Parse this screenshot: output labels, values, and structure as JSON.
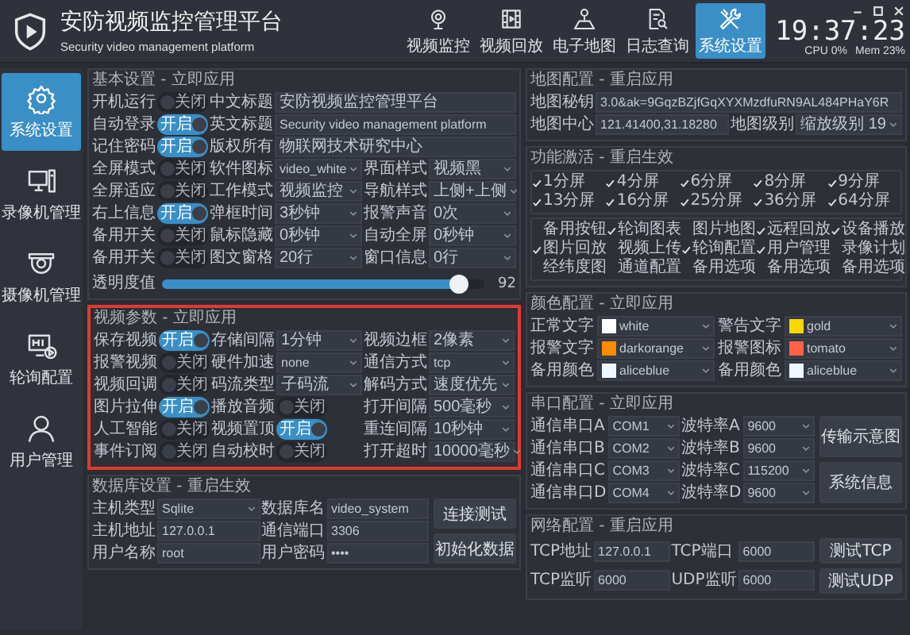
{
  "header": {
    "title": "安防视频监控管理平台",
    "subtitle": "Security video management platform",
    "nav": [
      {
        "label": "视频监控",
        "selected": false
      },
      {
        "label": "视频回放",
        "selected": false
      },
      {
        "label": "电子地图",
        "selected": false
      },
      {
        "label": "日志查询",
        "selected": false
      },
      {
        "label": "系统设置",
        "selected": true
      }
    ],
    "clock": "19:37:23",
    "cpu": "CPU 0%",
    "mem": "Mem 23%"
  },
  "sidebar": {
    "items": [
      {
        "label": "系统设置",
        "selected": true
      },
      {
        "label": "录像机管理",
        "selected": false
      },
      {
        "label": "摄像机管理",
        "selected": false
      },
      {
        "label": "轮询配置",
        "selected": false
      },
      {
        "label": "用户管理",
        "selected": false
      }
    ]
  },
  "basic": {
    "title": "基本设置 - 立即应用",
    "rows": [
      {
        "cells": [
          {
            "kind": "toggle",
            "label": "开机运行",
            "on": false,
            "text": "关闭"
          },
          {
            "kind": "field",
            "label": "中文标题",
            "value": "安防视频监控管理平台"
          }
        ]
      },
      {
        "cells": [
          {
            "kind": "toggle",
            "label": "自动登录",
            "on": true,
            "text": "开启"
          },
          {
            "kind": "field",
            "label": "英文标题",
            "value": "Security video management platform"
          }
        ]
      },
      {
        "cells": [
          {
            "kind": "toggle",
            "label": "记住密码",
            "on": true,
            "text": "开启"
          },
          {
            "kind": "field",
            "label": "版权所有",
            "value": "物联网技术研究中心"
          }
        ]
      },
      {
        "cells": [
          {
            "kind": "toggle",
            "label": "全屏模式",
            "on": false,
            "text": "关闭"
          },
          {
            "kind": "select",
            "label": "软件图标",
            "value": "video_white"
          },
          {
            "kind": "select",
            "label": "界面样式",
            "value": "视频黑"
          }
        ]
      },
      {
        "cells": [
          {
            "kind": "toggle",
            "label": "全屏适应",
            "on": false,
            "text": "关闭"
          },
          {
            "kind": "select",
            "label": "工作模式",
            "value": "视频监控"
          },
          {
            "kind": "select",
            "label": "导航样式",
            "value": "上侧+上侧"
          }
        ]
      },
      {
        "cells": [
          {
            "kind": "toggle",
            "label": "右上信息",
            "on": true,
            "text": "开启"
          },
          {
            "kind": "select",
            "label": "弹框时间",
            "value": "3秒钟"
          },
          {
            "kind": "select",
            "label": "报警声音",
            "value": "0次"
          }
        ]
      },
      {
        "cells": [
          {
            "kind": "toggle",
            "label": "备用开关",
            "on": false,
            "text": "关闭"
          },
          {
            "kind": "select",
            "label": "鼠标隐藏",
            "value": "0秒钟"
          },
          {
            "kind": "select",
            "label": "自动全屏",
            "value": "0秒钟"
          }
        ]
      },
      {
        "cells": [
          {
            "kind": "toggle",
            "label": "备用开关",
            "on": false,
            "text": "关闭"
          },
          {
            "kind": "select",
            "label": "图文窗格",
            "value": "20行"
          },
          {
            "kind": "select",
            "label": "窗口信息",
            "value": "0行"
          }
        ]
      }
    ],
    "slider": {
      "label": "透明度值",
      "level": 0.92,
      "reading": "92"
    }
  },
  "video": {
    "title": "视频参数 - 立即应用",
    "highlighted": true,
    "rows": [
      {
        "cells": [
          {
            "kind": "toggle",
            "label": "保存视频",
            "on": true,
            "text": "开启"
          },
          {
            "kind": "select",
            "label": "存储间隔",
            "value": "1分钟"
          },
          {
            "kind": "select",
            "label": "视频边框",
            "value": "2像素"
          }
        ]
      },
      {
        "cells": [
          {
            "kind": "toggle",
            "label": "报警视频",
            "on": false,
            "text": "关闭"
          },
          {
            "kind": "select",
            "label": "硬件加速",
            "value": "none"
          },
          {
            "kind": "select",
            "label": "通信方式",
            "value": "tcp"
          }
        ]
      },
      {
        "cells": [
          {
            "kind": "toggle",
            "label": "视频回调",
            "on": false,
            "text": "关闭"
          },
          {
            "kind": "select",
            "label": "码流类型",
            "value": "子码流"
          },
          {
            "kind": "select",
            "label": "解码方式",
            "value": "速度优先"
          }
        ]
      },
      {
        "cells": [
          {
            "kind": "toggle",
            "label": "图片拉伸",
            "on": true,
            "text": "开启"
          },
          {
            "kind": "toggle",
            "label": "播放音频",
            "on": false,
            "text": "关闭"
          },
          {
            "kind": "select",
            "label": "打开间隔",
            "value": "500毫秒"
          }
        ]
      },
      {
        "cells": [
          {
            "kind": "toggle",
            "label": "人工智能",
            "on": false,
            "text": "关闭"
          },
          {
            "kind": "toggle",
            "label": "视频置顶",
            "on": true,
            "text": "开启"
          },
          {
            "kind": "select",
            "label": "重连间隔",
            "value": "10秒钟"
          }
        ]
      },
      {
        "cells": [
          {
            "kind": "toggle",
            "label": "事件订阅",
            "on": false,
            "text": "关闭"
          },
          {
            "kind": "toggle",
            "label": "自动校时",
            "on": false,
            "text": "关闭"
          },
          {
            "kind": "select",
            "label": "打开超时",
            "value": "10000毫秒"
          }
        ]
      }
    ]
  },
  "database": {
    "title": "数据库设置 - 重启生效",
    "rows": [
      {
        "cells": [
          {
            "kind": "select",
            "label": "主机类型",
            "value": "Sqlite"
          },
          {
            "kind": "field",
            "label": "数据库名",
            "value": "video_system"
          }
        ]
      },
      {
        "cells": [
          {
            "kind": "field",
            "label": "主机地址",
            "value": "127.0.0.1"
          },
          {
            "kind": "field",
            "label": "通信端口",
            "value": "3306"
          }
        ]
      },
      {
        "cells": [
          {
            "kind": "field",
            "label": "用户名称",
            "value": "root"
          },
          {
            "kind": "field",
            "label": "用户密码",
            "value": "••••"
          }
        ]
      }
    ],
    "buttons": [
      "连接测试",
      "初始化数据"
    ]
  },
  "map": {
    "title": "地图配置 - 重启应用",
    "rows": [
      {
        "cells": [
          {
            "kind": "field",
            "label": "地图秘钥",
            "value": "3.0&ak=9GqzBZjfGqXYXMzdfuRN9AL484PHaY6R"
          }
        ]
      },
      {
        "cells": [
          {
            "kind": "field",
            "label": "地图中心",
            "value": "121.41400,31.18280"
          },
          {
            "kind": "select",
            "label": "地图级别",
            "value": "缩放级别 19"
          }
        ]
      }
    ]
  },
  "features": {
    "title": "功能激活 - 重启生效",
    "screens": [
      {
        "label": "1分屏",
        "checked": true
      },
      {
        "label": "4分屏",
        "checked": true
      },
      {
        "label": "6分屏",
        "checked": true
      },
      {
        "label": "8分屏",
        "checked": true
      },
      {
        "label": "9分屏",
        "checked": true
      },
      {
        "label": "13分屏",
        "checked": true
      },
      {
        "label": "16分屏",
        "checked": true
      },
      {
        "label": "25分屏",
        "checked": true
      },
      {
        "label": "36分屏",
        "checked": true
      },
      {
        "label": "64分屏",
        "checked": true
      }
    ],
    "functions": [
      {
        "label": "备用按钮",
        "checked": false
      },
      {
        "label": "轮询图表",
        "checked": true
      },
      {
        "label": "图片地图",
        "checked": false
      },
      {
        "label": "远程回放",
        "checked": true
      },
      {
        "label": "设备播放",
        "checked": true
      },
      {
        "label": "图片回放",
        "checked": true
      },
      {
        "label": "视频上传",
        "checked": false
      },
      {
        "label": "轮询配置",
        "checked": true
      },
      {
        "label": "用户管理",
        "checked": true
      },
      {
        "label": "录像计划",
        "checked": false
      },
      {
        "label": "经纬度图",
        "checked": false
      },
      {
        "label": "通道配置",
        "checked": false
      },
      {
        "label": "备用选项",
        "checked": false
      },
      {
        "label": "备用选项",
        "checked": false
      },
      {
        "label": "备用选项",
        "checked": false
      }
    ]
  },
  "colors": {
    "title": "颜色配置 - 立即应用",
    "items": [
      {
        "label": "正常文字",
        "value": "white",
        "color": "#ffffff"
      },
      {
        "label": "警告文字",
        "value": "gold",
        "color": "#ffd700"
      },
      {
        "label": "报警文字",
        "value": "darkorange",
        "color": "#ff8c00"
      },
      {
        "label": "报警图标",
        "value": "tomato",
        "color": "#ff6347"
      },
      {
        "label": "备用颜色",
        "value": "aliceblue",
        "color": "#f0f8ff"
      },
      {
        "label": "备用颜色",
        "value": "aliceblue",
        "color": "#f0f8ff"
      }
    ]
  },
  "serial": {
    "title": "串口配置 - 立即应用",
    "rows": [
      {
        "cells": [
          {
            "kind": "select",
            "label": "通信串口A",
            "value": "COM1"
          },
          {
            "kind": "select",
            "label": "波特率A",
            "value": "9600"
          }
        ]
      },
      {
        "cells": [
          {
            "kind": "select",
            "label": "通信串口B",
            "value": "COM2"
          },
          {
            "kind": "select",
            "label": "波特率B",
            "value": "9600"
          }
        ]
      },
      {
        "cells": [
          {
            "kind": "select",
            "label": "通信串口C",
            "value": "COM3"
          },
          {
            "kind": "select",
            "label": "波特率C",
            "value": "115200"
          }
        ]
      },
      {
        "cells": [
          {
            "kind": "select",
            "label": "通信串口D",
            "value": "COM4"
          },
          {
            "kind": "select",
            "label": "波特率D",
            "value": "9600"
          }
        ]
      }
    ],
    "buttons": [
      "传输示意图",
      "系统信息"
    ]
  },
  "network": {
    "title": "网络配置 - 重启应用",
    "rows": [
      {
        "cells": [
          {
            "kind": "field",
            "label": "TCP地址",
            "value": "127.0.0.1"
          },
          {
            "kind": "field",
            "label": "TCP端口",
            "value": "6000"
          }
        ]
      },
      {
        "cells": [
          {
            "kind": "field",
            "label": "TCP监听",
            "value": "6000"
          },
          {
            "kind": "field",
            "label": "UDP监听",
            "value": "6000"
          }
        ]
      }
    ],
    "buttons": [
      "测试TCP",
      "测试UDP"
    ]
  }
}
